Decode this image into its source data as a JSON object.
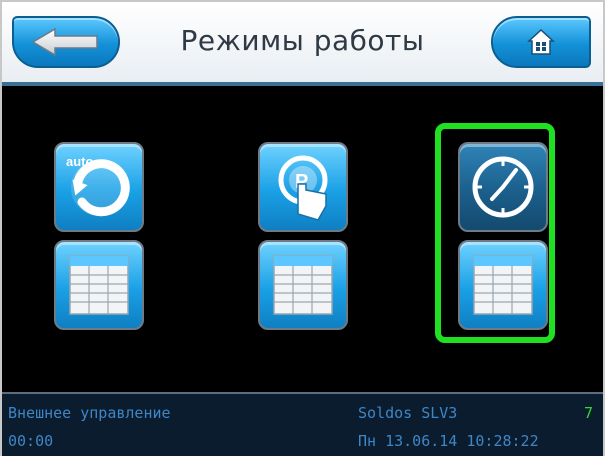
{
  "header": {
    "title": "Режимы работы",
    "back_icon": "arrow-left-icon",
    "home_icon": "home-icon"
  },
  "tiles": [
    {
      "id": "auto-mode",
      "icon": "auto-cycle-icon",
      "badge_text": "auto."
    },
    {
      "id": "manual-mode",
      "icon": "touch-hand-icon",
      "badge_text": "P"
    },
    {
      "id": "timer-mode",
      "icon": "clock-icon",
      "selected": true
    },
    {
      "id": "auto-table",
      "icon": "table-icon"
    },
    {
      "id": "manual-table",
      "icon": "table-icon"
    },
    {
      "id": "timer-table",
      "icon": "table-icon"
    }
  ],
  "status": {
    "source": "Внешнее управление",
    "time": "00:00",
    "device": "Soldos SLV3",
    "count": "7",
    "datetime": "Пн 13.06.14 10:28:22"
  },
  "colors": {
    "selection": "#20e022",
    "status_text": "#3e86c6",
    "status_count": "#33d633",
    "tile_blue": "#1aa0e6"
  }
}
